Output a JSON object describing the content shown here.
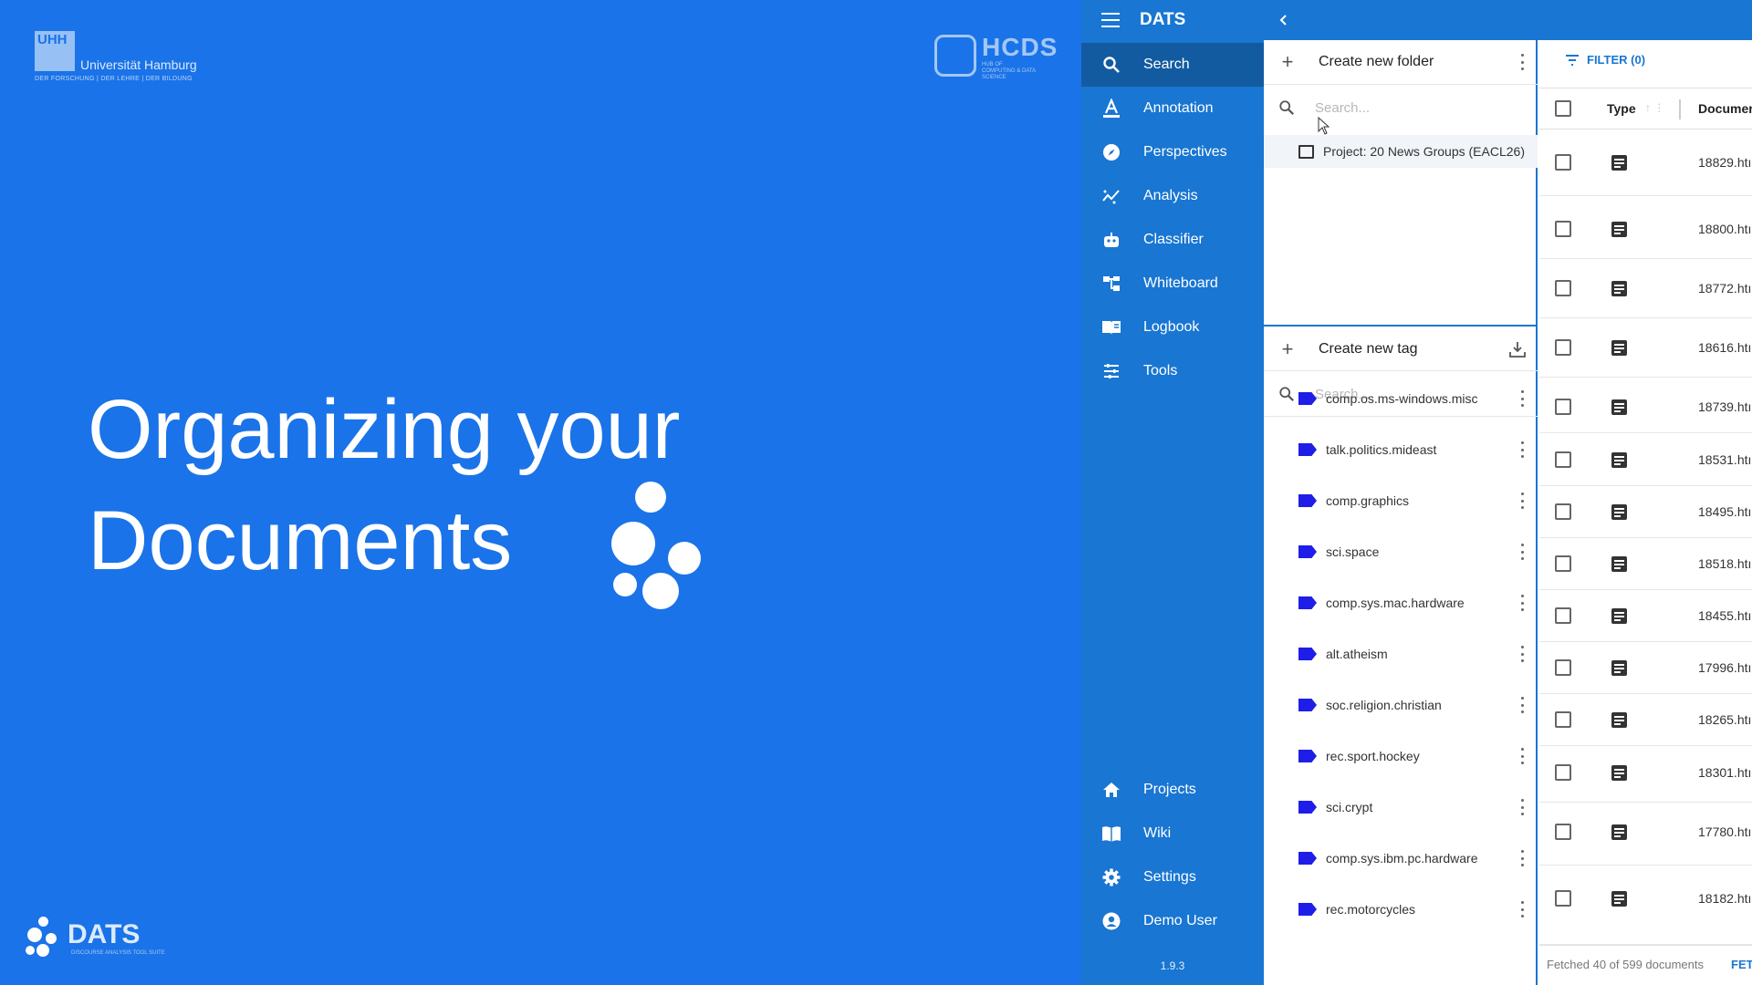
{
  "slide": {
    "university_logo_text": "Universität Hamburg",
    "university_logo_mark": "UHH",
    "university_tagline": "DER FORSCHUNG | DER LEHRE | DER BILDUNG",
    "hcds_logo_text": "HCDS",
    "hcds_logo_sub": "HUB OF COMPUTING & DATA SCIENCE",
    "headline_line1": "Organizing your",
    "headline_line2": "Documents",
    "dats_logo_text": "DATS",
    "dats_logo_sub": "DISCOURSE ANALYSIS TOOL SUITE"
  },
  "sidebar": {
    "title": "DATS",
    "menu_icon": "hamburger-icon",
    "items": [
      {
        "label": "Search",
        "icon": "search-icon",
        "active": true
      },
      {
        "label": "Annotation",
        "icon": "annotation-icon"
      },
      {
        "label": "Perspectives",
        "icon": "compass-icon"
      },
      {
        "label": "Analysis",
        "icon": "analysis-icon"
      },
      {
        "label": "Classifier",
        "icon": "robot-icon"
      },
      {
        "label": "Whiteboard",
        "icon": "whiteboard-icon"
      },
      {
        "label": "Logbook",
        "icon": "logbook-icon"
      },
      {
        "label": "Tools",
        "icon": "tools-icon"
      }
    ],
    "bottom_items": [
      {
        "label": "Projects",
        "icon": "home-icon"
      },
      {
        "label": "Wiki",
        "icon": "book-icon"
      },
      {
        "label": "Settings",
        "icon": "gear-icon"
      },
      {
        "label": "Demo User",
        "icon": "account-icon"
      }
    ],
    "version": "1.9.3"
  },
  "folders": {
    "create_label": "Create new folder",
    "search_placeholder": "Search...",
    "project_label": "Project: 20 News Groups (EACL26)"
  },
  "tags": {
    "create_label": "Create new tag",
    "search_placeholder": "Search...",
    "tag_color": "#1e1ee8",
    "items": [
      "comp.os.ms-windows.misc",
      "talk.politics.mideast",
      "comp.graphics",
      "sci.space",
      "comp.sys.mac.hardware",
      "alt.atheism",
      "soc.religion.christian",
      "rec.sport.hockey",
      "sci.crypt",
      "comp.sys.ibm.pc.hardware",
      "rec.motorcycles"
    ]
  },
  "documents": {
    "filter_label": "FILTER (0)",
    "col_type": "Type",
    "col_document": "Documer",
    "rows": [
      "18829.htı",
      "18800.htı",
      "18772.htı",
      "18616.htı",
      "18739.htı",
      "18531.htı",
      "18495.htı",
      "18518.htı",
      "18455.htı",
      "17996.htı",
      "18265.htı",
      "18301.htı",
      "17780.htı",
      "18182.htı"
    ],
    "footer_text": "Fetched 40 of 599 documents",
    "footer_link": "FET"
  },
  "colors": {
    "slide_bg": "#1a73e8",
    "sidebar_bg": "#1976d2",
    "accent": "#1976d2"
  }
}
